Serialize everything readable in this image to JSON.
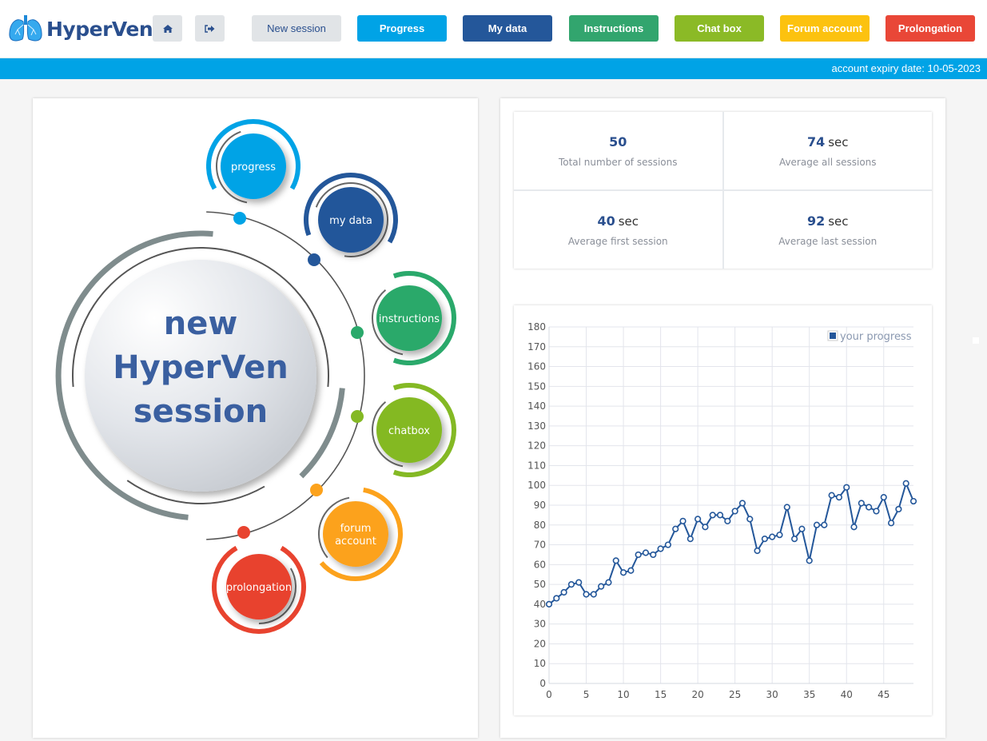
{
  "header": {
    "logo_text": "HyperVen",
    "home_icon": "home-icon",
    "logout_icon": "sign-out-icon",
    "nav": [
      {
        "label": "New session",
        "color": "#e1e4e7",
        "text_color": "#2a4f8e"
      },
      {
        "label": "Progress",
        "color": "#00a3e6",
        "text_color": "#ffffff"
      },
      {
        "label": "My data",
        "color": "#24579a",
        "text_color": "#ffffff"
      },
      {
        "label": "Instructions",
        "color": "#32a56e",
        "text_color": "#ffffff"
      },
      {
        "label": "Chat box",
        "color": "#8bba26",
        "text_color": "#ffffff"
      },
      {
        "label": "Forum account",
        "color": "#fcc20f",
        "text_color": "#ffffff"
      },
      {
        "label": "Prolongation",
        "color": "#e94737",
        "text_color": "#ffffff"
      }
    ],
    "expiry": "account expiry date: 10-05-2023"
  },
  "hub": {
    "center": [
      "new",
      "HyperVen",
      "session"
    ],
    "items": [
      {
        "label": "progress",
        "color": "#00a3e6"
      },
      {
        "label": "my data",
        "color": "#24579a"
      },
      {
        "label": "instructions",
        "color": "#2aa96b"
      },
      {
        "label": "chatbox",
        "color": "#84b924"
      },
      {
        "label": "forum account",
        "color": "#fca21c"
      },
      {
        "label": "prolongation",
        "color": "#e8432f"
      }
    ]
  },
  "stats": [
    {
      "value": "50",
      "unit": "",
      "label": "Total number of sessions"
    },
    {
      "value": "74",
      "unit": "sec",
      "label": "Average all sessions"
    },
    {
      "value": "40",
      "unit": "sec",
      "label": "Average first session"
    },
    {
      "value": "92",
      "unit": "sec",
      "label": "Average last session"
    }
  ],
  "chart_data": {
    "type": "line",
    "title": "",
    "xlabel": "",
    "ylabel": "",
    "xlim": [
      0,
      49
    ],
    "ylim": [
      0,
      180
    ],
    "x_ticks": [
      0,
      5,
      10,
      15,
      20,
      25,
      30,
      35,
      40,
      45
    ],
    "y_ticks": [
      0,
      10,
      20,
      30,
      40,
      50,
      60,
      70,
      80,
      90,
      100,
      110,
      120,
      130,
      140,
      150,
      160,
      170,
      180
    ],
    "grid": true,
    "legend_position": "top-right",
    "series": [
      {
        "name": "your progress",
        "color": "#24579a",
        "x": [
          0,
          1,
          2,
          3,
          4,
          5,
          6,
          7,
          8,
          9,
          10,
          11,
          12,
          13,
          14,
          15,
          16,
          17,
          18,
          19,
          20,
          21,
          22,
          23,
          24,
          25,
          26,
          27,
          28,
          29,
          30,
          31,
          32,
          33,
          34,
          35,
          36,
          37,
          38,
          39,
          40,
          41,
          42,
          43,
          44,
          45,
          46,
          47,
          48,
          49
        ],
        "values": [
          40,
          43,
          46,
          50,
          51,
          45,
          45,
          49,
          51,
          62,
          56,
          57,
          65,
          66,
          65,
          68,
          70,
          78,
          82,
          73,
          83,
          79,
          85,
          85,
          82,
          87,
          91,
          83,
          67,
          73,
          74,
          75,
          89,
          73,
          78,
          62,
          80,
          80,
          95,
          94,
          99,
          79,
          91,
          89,
          87,
          94,
          81,
          88,
          101,
          92
        ]
      }
    ]
  }
}
